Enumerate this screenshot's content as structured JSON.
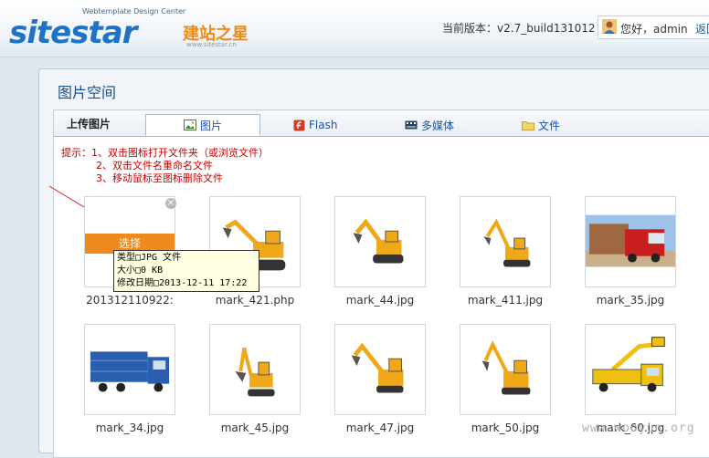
{
  "header": {
    "logo_main": "sitestar",
    "logo_cn": "建站之星",
    "logo_sub": "Webtemplate Design Center",
    "logo_url": "www.sitestar.cn",
    "version_label": "当前版本：",
    "version_value": "v2.7_build131012",
    "greeting": "您好，admin",
    "logout": "返回"
  },
  "panel": {
    "title": "图片空间",
    "upload_label": "上传图片",
    "tabs": [
      {
        "label": "图片",
        "icon": "image-icon",
        "active": true
      },
      {
        "label": "Flash",
        "icon": "flash-icon",
        "active": false
      },
      {
        "label": "多媒体",
        "icon": "media-icon",
        "active": false
      },
      {
        "label": "文件",
        "icon": "folder-icon",
        "active": false
      }
    ],
    "hints": [
      "提示：1、双击图标打开文件夹（或浏览文件）",
      "2、双击文件名重命名文件",
      "3、移动鼠标至图标删除文件"
    ]
  },
  "files": [
    {
      "name": "201312110922:",
      "thumb": "blank",
      "hovered": true
    },
    {
      "name": "mark_421.php",
      "thumb": "excavator"
    },
    {
      "name": "mark_44.jpg",
      "thumb": "excavator"
    },
    {
      "name": "mark_411.jpg",
      "thumb": "excavator"
    },
    {
      "name": "mark_35.jpg",
      "thumb": "red-truck"
    },
    {
      "name": "mark_34.jpg",
      "thumb": "blue-truck"
    },
    {
      "name": "mark_45.jpg",
      "thumb": "excavator"
    },
    {
      "name": "mark_47.jpg",
      "thumb": "excavator"
    },
    {
      "name": "mark_50.jpg",
      "thumb": "excavator"
    },
    {
      "name": "mark_60.jpg",
      "thumb": "lift-truck"
    }
  ],
  "hover": {
    "select_label": "选择",
    "close_label": "×",
    "tooltip": [
      "类型□JPG 文件",
      "大小□0 KB",
      "修改日期□2013-12-11 17:22"
    ]
  },
  "watermark": "www.wooyun.org",
  "colors": {
    "accent": "#1f73c7",
    "orange": "#f08a1c",
    "hint_red": "#c40000",
    "excavator_yellow": "#f0a818"
  }
}
